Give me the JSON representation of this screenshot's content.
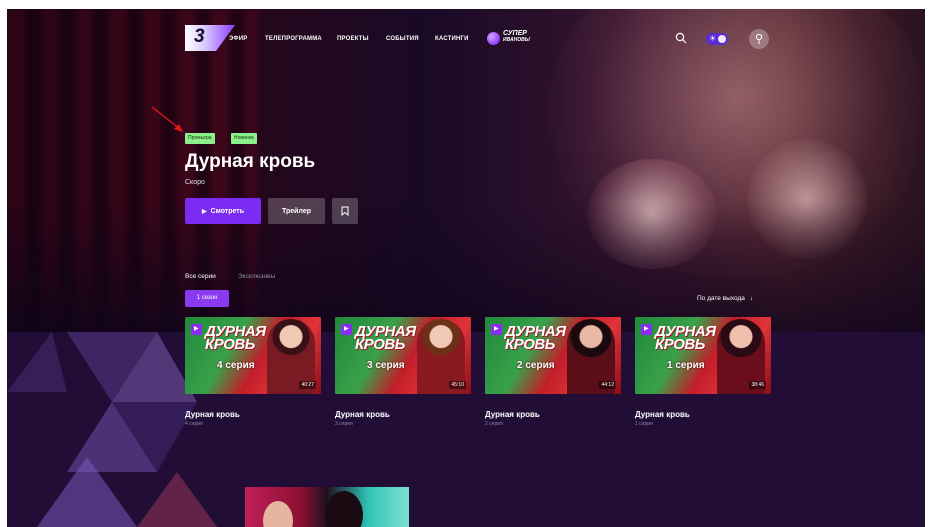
{
  "nav": {
    "items": [
      "ЭФИР",
      "ТЕЛЕПРОГРАММА",
      "ПРОЕКТЫ",
      "СОБЫТИЯ",
      "КАСТИНГИ"
    ],
    "logo_number": "3",
    "brand_line1": "СУПЕР",
    "brand_line2": "ИВАНОВЫ"
  },
  "hero": {
    "badges": [
      "Премьера",
      "Новинка"
    ],
    "title": "Дурная кровь",
    "status": "Скоро",
    "watch_label": "Смотреть",
    "trailer_label": "Трейлер"
  },
  "episodes": {
    "tabs": [
      "Все серии",
      "Эксклюзивы"
    ],
    "season_label": "1 сезон",
    "sort_label": "По дате выхода",
    "cards": [
      {
        "title": "Дурная кровь",
        "subtitle": "4 серия",
        "episode_label": "4 серия",
        "duration": "40:27",
        "logo": "ДУРНАЯ КРОВЬ"
      },
      {
        "title": "Дурная кровь",
        "subtitle": "3 серия",
        "episode_label": "3 серия",
        "duration": "45:10",
        "logo": "ДУРНАЯ КРОВЬ"
      },
      {
        "title": "Дурная кровь",
        "subtitle": "2 серия",
        "episode_label": "2 серия",
        "duration": "44:12",
        "logo": "ДУРНАЯ КРОВЬ"
      },
      {
        "title": "Дурная кровь",
        "subtitle": "1 серия",
        "episode_label": "1 серия",
        "duration": "38:46",
        "logo": "ДУРНАЯ КРОВЬ"
      }
    ]
  },
  "colors": {
    "accent": "#7b2cf2",
    "badge": "#8cf08a",
    "background": "#220d36"
  }
}
